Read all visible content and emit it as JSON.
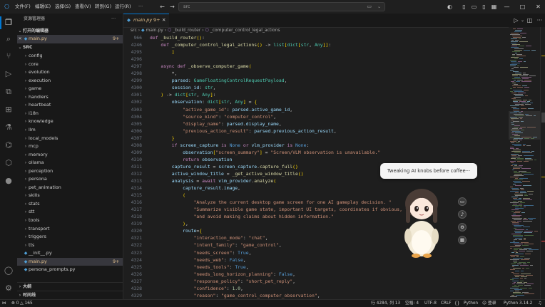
{
  "menu": {
    "items": [
      "文件(F)",
      "编辑(E)",
      "选择(S)",
      "查看(V)",
      "转到(G)",
      "运行(R)"
    ],
    "more": "···",
    "search_text": "src",
    "window_controls": {
      "minimize": "—",
      "maximize": "□",
      "close": "✕"
    }
  },
  "sidebar": {
    "title": "资源管理器",
    "open_editors_label": "打开的编辑器",
    "open_editor_file": "main.py",
    "open_editor_badge": "9+",
    "root_label": "SRC",
    "folders": [
      "config",
      "core",
      "evolution",
      "execution",
      "game",
      "handlers",
      "heartbeat",
      "i18n",
      "knowledge",
      "llm",
      "local_models",
      "mcp",
      "memory",
      "ollama",
      "perception",
      "persona",
      "pet_animation",
      "skills",
      "stats",
      "stt",
      "tools",
      "transport",
      "triggers",
      "tts"
    ],
    "files": [
      {
        "name": "__init__.py",
        "badge": ""
      },
      {
        "name": "main.py",
        "badge": "9+"
      },
      {
        "name": "persona_prompts.py",
        "badge": ""
      }
    ],
    "outline_label": "大纲",
    "timeline_label": "时间线"
  },
  "editor": {
    "tab_label": "main.py",
    "tab_badge": "9+",
    "breadcrumb": [
      "src",
      "main.py",
      "_build_router",
      "_computer_control_legal_actions"
    ],
    "lines": [
      {
        "n": "966",
        "t": "def _build_router():"
      },
      {
        "n": "4246",
        "t": "    def _computer_control_legal_actions() -> list[dict[str, Any]]:"
      },
      {
        "n": "4295",
        "t": "        ]"
      },
      {
        "n": "4296",
        "t": ""
      },
      {
        "n": "4297",
        "t": "    async def _observe_computer_game("
      },
      {
        "n": "4298",
        "t": "        *,"
      },
      {
        "n": "4299",
        "t": "        parsed: GameFloatingControlRequestPayload,"
      },
      {
        "n": "4300",
        "t": "        session_id: str,"
      },
      {
        "n": "4301",
        "t": "    ) -> dict[str, Any]:"
      },
      {
        "n": "4302",
        "t": "        observation: dict[str, Any] = {"
      },
      {
        "n": "4303",
        "t": "            \"active_game_id\": parsed.active_game_id,"
      },
      {
        "n": "4304",
        "t": "            \"source_kind\": \"computer_control\","
      },
      {
        "n": "4305",
        "t": "            \"display_name\": parsed.display_name,"
      },
      {
        "n": "4306",
        "t": "            \"previous_action_result\": parsed.previous_action_result,"
      },
      {
        "n": "4307",
        "t": "        }"
      },
      {
        "n": "4308",
        "t": "        if screen_capture is None or vlm_provider is None:"
      },
      {
        "n": "4309",
        "t": "            observation[\"screen_summary\"] = \"Screen/VLM observation is unavailable.\""
      },
      {
        "n": "4310",
        "t": "            return observation"
      },
      {
        "n": "4311",
        "t": "        capture_result = screen_capture.capture_full()"
      },
      {
        "n": "4312",
        "t": "        active_window_title = _get_active_window_title()"
      },
      {
        "n": "4313",
        "t": "        analysis = await vlm_provider.analyze("
      },
      {
        "n": "4314",
        "t": "            capture_result.image,"
      },
      {
        "n": "4315",
        "t": "            ("
      },
      {
        "n": "4316",
        "t": "                \"Analyze the current desktop game screen for one AI gameplay decision. \""
      },
      {
        "n": "4317",
        "t": "                \"Summarize visible game state, important UI targets, coordinates if obvious, \""
      },
      {
        "n": "4318",
        "t": "                \"and avoid making claims about hidden information.\""
      },
      {
        "n": "4319",
        "t": "            ),"
      },
      {
        "n": "4320",
        "t": "            route={"
      },
      {
        "n": "4321",
        "t": "                \"interaction_mode\": \"chat\","
      },
      {
        "n": "4322",
        "t": "                \"intent_family\": \"game_control\","
      },
      {
        "n": "4323",
        "t": "                \"needs_screen\": True,"
      },
      {
        "n": "4324",
        "t": "                \"needs_web\": False,"
      },
      {
        "n": "4325",
        "t": "                \"needs_tools\": True,"
      },
      {
        "n": "4326",
        "t": "                \"needs_long_horizon_planning\": False,"
      },
      {
        "n": "4327",
        "t": "                \"response_policy\": \"short_pet_reply\","
      },
      {
        "n": "4328",
        "t": "                \"confidence\": 1.0,"
      },
      {
        "n": "4329",
        "t": "                \"reason\": \"game_control_computer_observation\","
      }
    ]
  },
  "statusbar": {
    "errors": "0",
    "warnings": "165",
    "position": "行 4284, 列 13",
    "spaces": "空格: 4",
    "encoding": "UTF-8",
    "eol": "CRLF",
    "braces": "{}",
    "language": "Python",
    "login": "登录",
    "python_version": "Python 3.14.2"
  },
  "pet": {
    "bubble_text": "Tweaking AI knobs before coffee···"
  }
}
